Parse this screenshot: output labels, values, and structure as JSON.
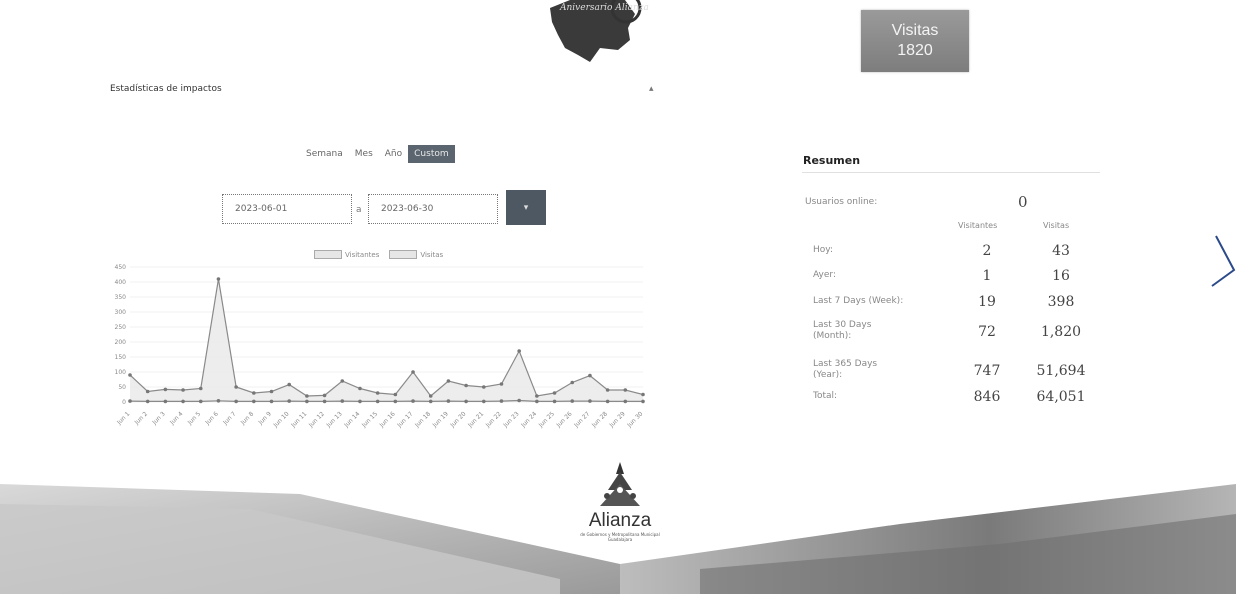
{
  "header": {
    "logo_text": "Aniversario Alianza",
    "visitas_label": "Visitas",
    "visitas_count": "1820"
  },
  "panel": {
    "title": "Estadísticas de impactos",
    "collapse_symbol": "▴"
  },
  "tabs": [
    {
      "label": "Semana",
      "active": false
    },
    {
      "label": "Mes",
      "active": false
    },
    {
      "label": "Año",
      "active": false
    },
    {
      "label": "Custom",
      "active": true
    }
  ],
  "date_range": {
    "from": "2023-06-01",
    "separator": "a",
    "to": "2023-06-30",
    "apply_symbol": "▾"
  },
  "chart_data": {
    "type": "line",
    "legend": [
      "Visitantes",
      "Visitas"
    ],
    "x": [
      "Jun 1",
      "Jun 2",
      "Jun 3",
      "Jun 4",
      "Jun 5",
      "Jun 6",
      "Jun 7",
      "Jun 8",
      "Jun 9",
      "Jun 10",
      "Jun 11",
      "Jun 12",
      "Jun 13",
      "Jun 14",
      "Jun 15",
      "Jun 16",
      "Jun 17",
      "Jun 18",
      "Jun 19",
      "Jun 20",
      "Jun 21",
      "Jun 22",
      "Jun 23",
      "Jun 24",
      "Jun 25",
      "Jun 26",
      "Jun 27",
      "Jun 28",
      "Jun 29",
      "Jun 30"
    ],
    "yticks": [
      0,
      50,
      100,
      150,
      200,
      250,
      300,
      350,
      400,
      450
    ],
    "ylim": [
      0,
      450
    ],
    "series": [
      {
        "name": "Visitantes",
        "values": [
          3,
          2,
          2,
          2,
          2,
          4,
          2,
          2,
          2,
          3,
          2,
          2,
          3,
          2,
          2,
          2,
          3,
          2,
          3,
          2,
          2,
          3,
          5,
          2,
          2,
          3,
          3,
          2,
          2,
          2
        ]
      },
      {
        "name": "Visitas",
        "values": [
          90,
          35,
          42,
          40,
          45,
          410,
          50,
          30,
          35,
          58,
          20,
          22,
          70,
          45,
          30,
          25,
          100,
          20,
          70,
          55,
          50,
          60,
          170,
          20,
          30,
          65,
          88,
          40,
          40,
          25
        ]
      }
    ],
    "colors": {
      "line": "#8a8a8a",
      "fill": "#e8e8e8",
      "points": "#777777"
    }
  },
  "resumen": {
    "title": "Resumen",
    "online_label": "Usuarios online:",
    "online_value": "0",
    "col_visitantes": "Visitantes",
    "col_visitas": "Visitas",
    "rows": [
      {
        "label": "Hoy:",
        "visitantes": "2",
        "visitas": "43"
      },
      {
        "label": "Ayer:",
        "visitantes": "1",
        "visitas": "16"
      },
      {
        "label": "Last 7 Days (Week):",
        "visitantes": "19",
        "visitas": "398"
      },
      {
        "label": "Last 30 Days (Month):",
        "visitantes": "72",
        "visitas": "1,820"
      },
      {
        "label": "Last 365 Days (Year):",
        "visitantes": "747",
        "visitas": "51,694"
      },
      {
        "label": "Total:",
        "visitantes": "846",
        "visitas": "64,051"
      }
    ]
  },
  "footer": {
    "brand": "Alianza",
    "sub": "de Gobiernos y Metropolitana Municipal Guadalajara"
  }
}
